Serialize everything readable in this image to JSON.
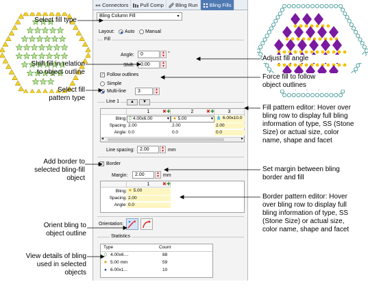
{
  "colors": {
    "accent": "#4e79b3",
    "diamond": "#7a1aa0",
    "dot_yellow": "#f2c200",
    "star_fill": "#b8e0a0",
    "triangle": "#f2d22a",
    "highlight": "#fdf6c3"
  },
  "tabs": [
    {
      "label": "Connectors",
      "icon": "connectors-icon"
    },
    {
      "label": "Pull Comp",
      "icon": "pull-comp-icon"
    },
    {
      "label": "Bling Run",
      "icon": "bling-run-icon"
    },
    {
      "label": "Bling Fills",
      "icon": "bling-fills-icon"
    }
  ],
  "fill_type": {
    "value": "Bling Column Fill"
  },
  "layout": {
    "label": "Layout:",
    "auto": "Auto",
    "manual": "Manual",
    "selected": "Auto"
  },
  "fill": {
    "group_title": "Fill",
    "angle_label": "Angle:",
    "angle_value": "0",
    "angle_unit": "°",
    "shift_label": "Shift:",
    "shift_value": "0.00",
    "follow_outlines": "Follow outlines",
    "simple": "Simple",
    "multiline": "Multi-line",
    "multiline_value": "3"
  },
  "line_editor": {
    "line_label": "Line 1",
    "columns": [
      "1",
      "2",
      "3"
    ],
    "row_labels": [
      "Bling:",
      "Spacing:",
      "Angle:"
    ],
    "bling": [
      "4.00x6.00",
      "5.00",
      "6.00x10.0"
    ],
    "spacing": [
      "2.00",
      "2.00",
      "2.00"
    ],
    "angle": [
      "0.0",
      "0.0",
      "0.0"
    ],
    "line_spacing_label": "Line spacing:",
    "line_spacing_value": "2.00",
    "line_spacing_unit": "mm"
  },
  "border": {
    "label": "Border",
    "margin_label": "Margin:",
    "margin_value": "2.00",
    "margin_unit": "mm",
    "column": "1",
    "row_labels": [
      "Bling:",
      "Spacing:",
      "Angle:"
    ],
    "bling": "5.00",
    "spacing": "2.00",
    "angle": "0.0"
  },
  "orientation": {
    "label": "Orientation:"
  },
  "statistics": {
    "group_title": "Statistics",
    "headers": [
      "Type",
      "Count"
    ],
    "rows": [
      {
        "type": "4.00x6....",
        "count": "88",
        "icon": "oval-bling-icon"
      },
      {
        "type": "5.00 mm",
        "count": "59",
        "icon": "star-bling-icon"
      },
      {
        "type": "6.00x1...",
        "count": "10",
        "icon": "drop-bling-icon"
      }
    ]
  },
  "callouts": {
    "select_fill_type": "Select fill type",
    "shift_fill": [
      "Shift fill in relation",
      "to object outline"
    ],
    "select_fill_pattern": [
      "Select fill",
      "pattern type"
    ],
    "add_border": [
      "Add border to",
      "selected bling-fill",
      "object"
    ],
    "orient_bling": [
      "Orient bling to",
      "object outline"
    ],
    "view_details": [
      "View details of bling",
      "used in selected",
      "objects"
    ],
    "adjust_fill_angle": "Adjust fill angle",
    "force_fill": [
      "Force fill to follow",
      "object outlines"
    ],
    "fill_pattern_editor": [
      "Fill pattern editor: Hover over",
      "bling row to display full bling",
      "information of type, SS (Stone",
      "Size) or actual size, color",
      "name, shape and facet"
    ],
    "set_margin": [
      "Set margin between bling",
      "border and fill"
    ],
    "border_pattern_editor": [
      "Border pattern editor: Hover",
      "over bling row to display full",
      "bling information of type, SS",
      "(Stone Size) or actual size,",
      "color name, shape and facet"
    ]
  }
}
